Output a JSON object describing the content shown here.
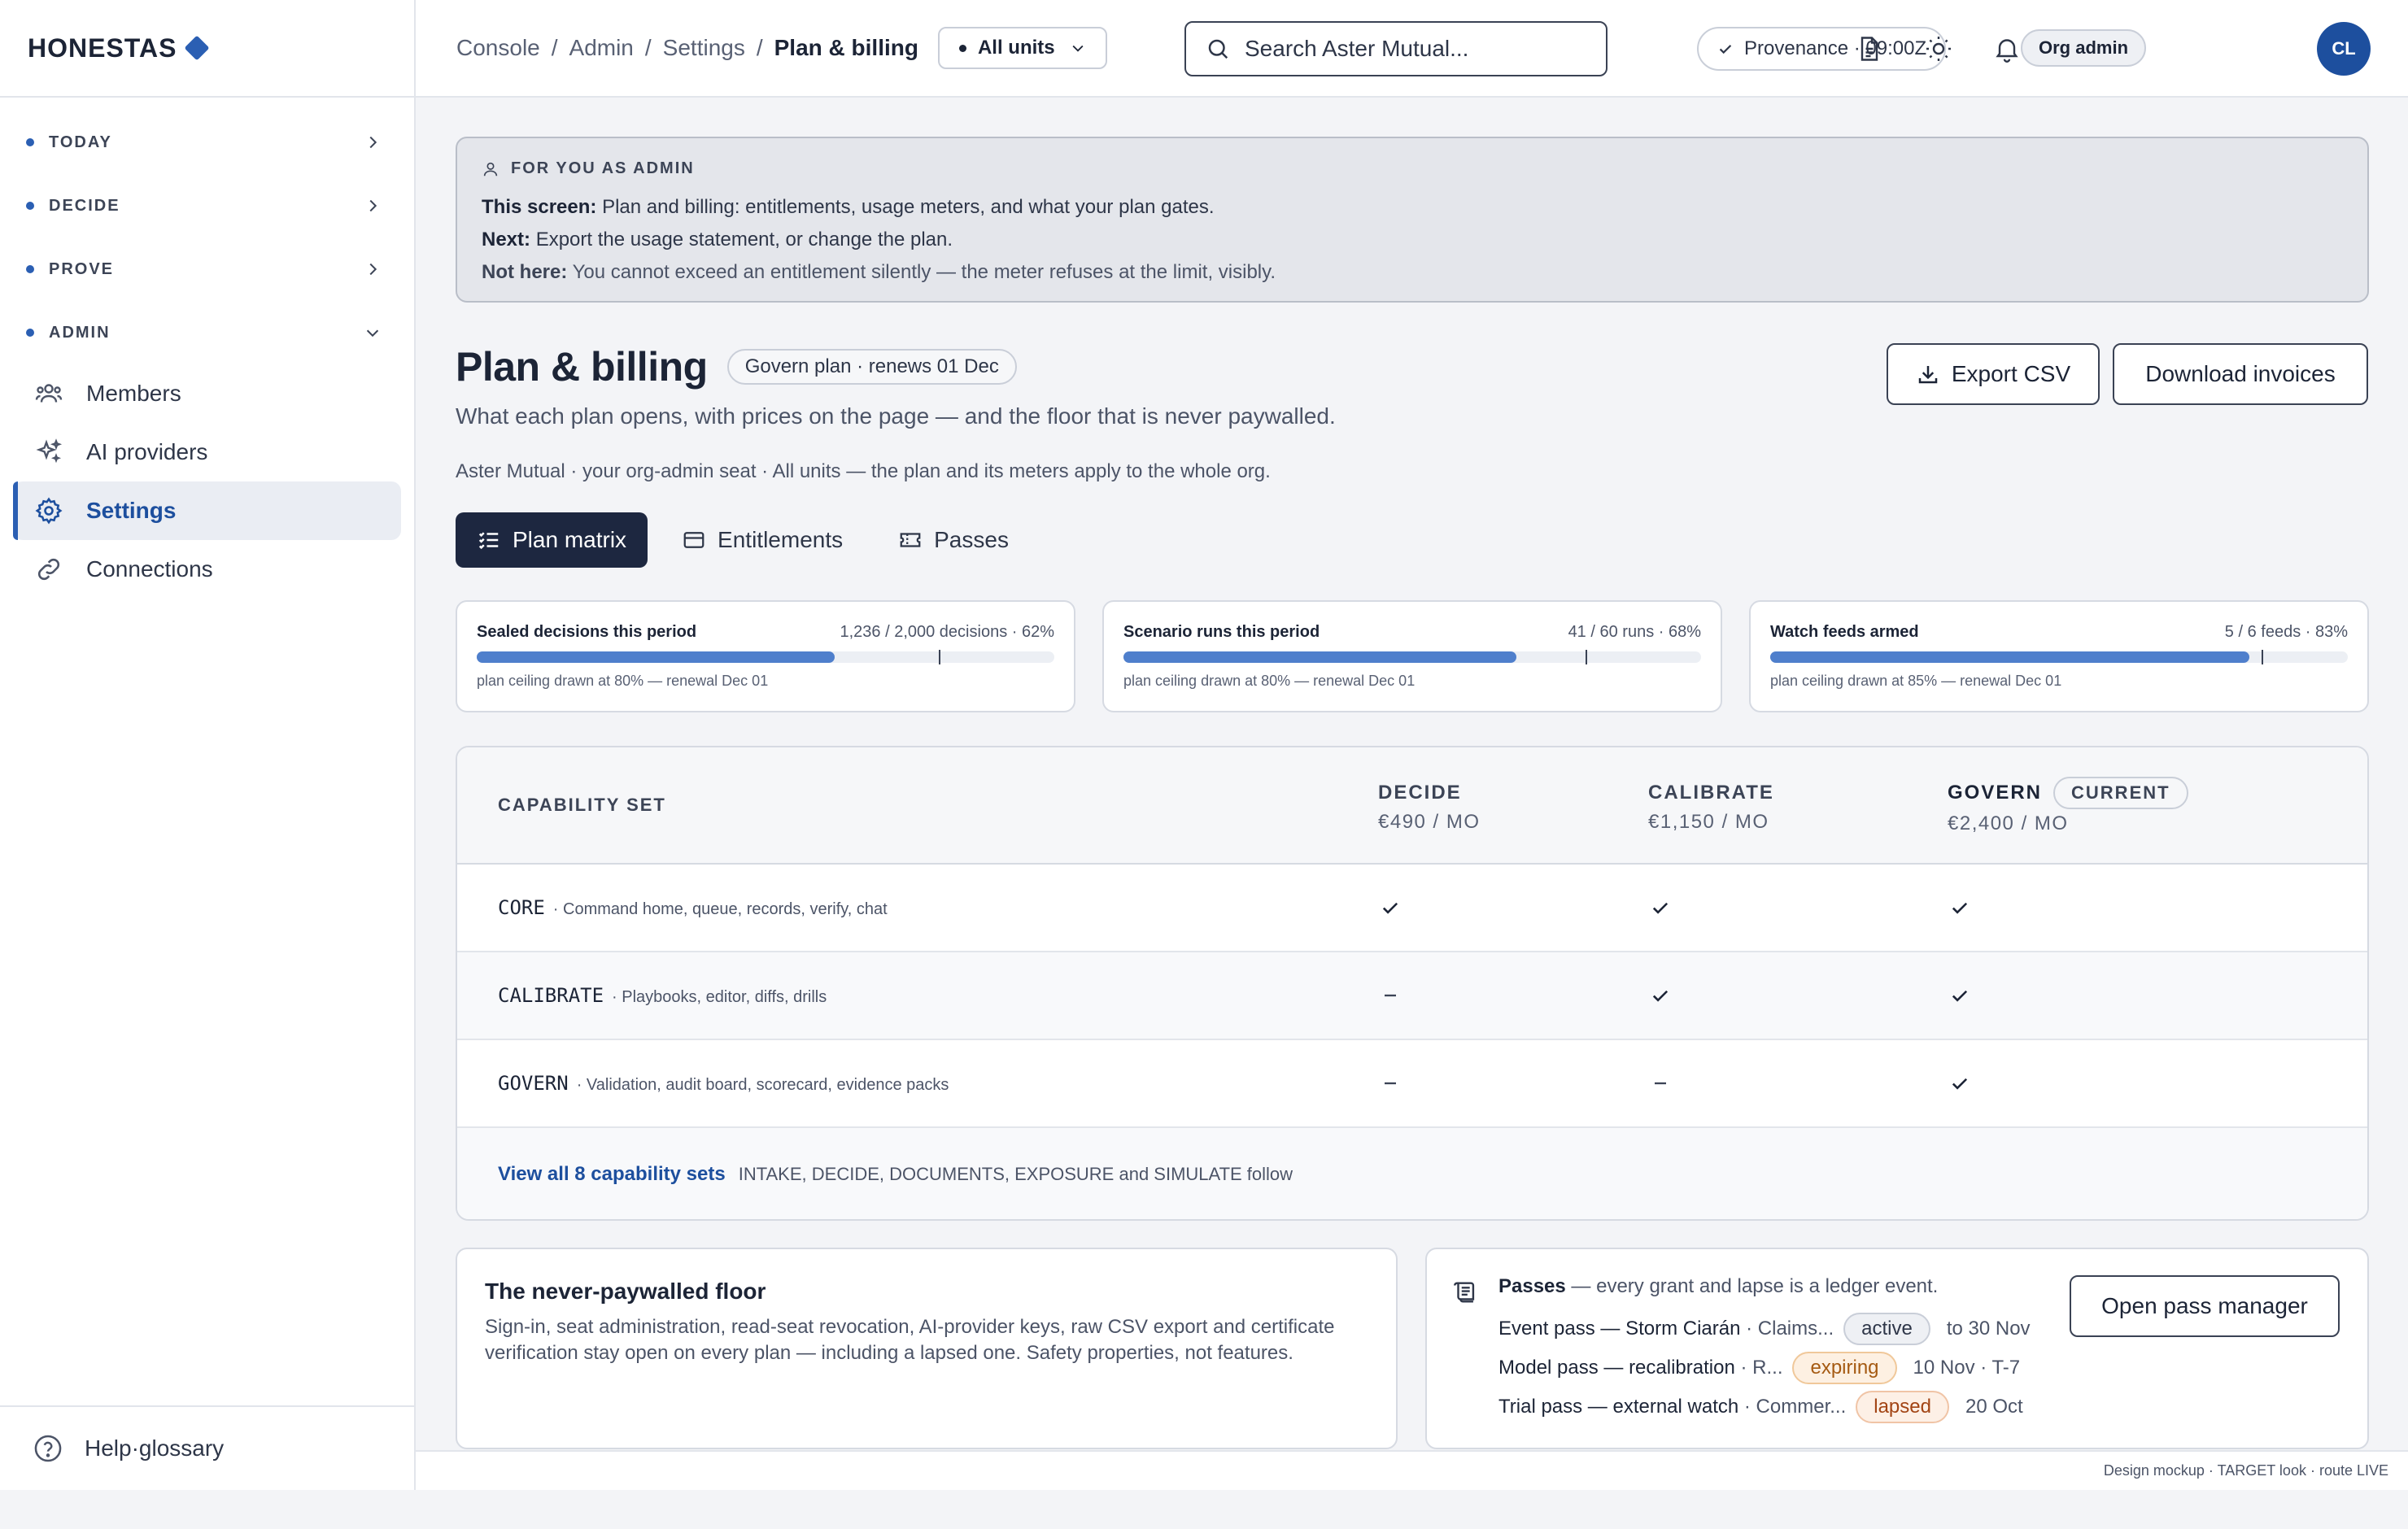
{
  "brand": {
    "name": "HONESTAS"
  },
  "nav": {
    "groups": [
      {
        "label": "TODAY"
      },
      {
        "label": "DECIDE"
      },
      {
        "label": "PROVE"
      },
      {
        "label": "ADMIN"
      }
    ],
    "admin_items": [
      {
        "label": "Members",
        "icon": "users-icon"
      },
      {
        "label": "AI providers",
        "icon": "sparkle-icon"
      },
      {
        "label": "Settings",
        "icon": "gear-icon",
        "active": true
      },
      {
        "label": "Connections",
        "icon": "link-icon"
      }
    ],
    "footer": {
      "label": "Help·glossary"
    }
  },
  "topbar": {
    "breadcrumb": [
      "Console",
      "Admin",
      "Settings",
      "Plan & billing"
    ],
    "units_label": "All units",
    "search_placeholder": "Search Aster Mutual...",
    "provenance": "Provenance · 09:00Z",
    "role": "Org admin",
    "avatar_initials": "CL"
  },
  "banner": {
    "kicker": "FOR YOU AS ADMIN",
    "lines": [
      {
        "label": "This screen:",
        "text": "Plan and billing: entitlements, usage meters, and what your plan gates."
      },
      {
        "label": "Next:",
        "text": "Export the usage statement, or change the plan."
      },
      {
        "label": "Not here:",
        "text": "You cannot exceed an entitlement silently — the meter refuses at the limit, visibly."
      }
    ]
  },
  "header": {
    "title": "Plan & billing",
    "plan_pill": "Govern plan · renews 01 Dec",
    "subtitle": "What each plan opens, with prices on the page — and the floor that is never paywalled.",
    "scope": "Aster Mutual · your org-admin seat · All units — the plan and its meters apply to the whole org.",
    "export_label": "Export CSV",
    "invoices_label": "Download invoices"
  },
  "tabs": [
    {
      "label": "Plan matrix",
      "active": true
    },
    {
      "label": "Entitlements"
    },
    {
      "label": "Passes"
    }
  ],
  "meters": [
    {
      "name": "Sealed decisions this period",
      "count": "1,236 / 2,000 decisions · 62%",
      "fill": 0.62,
      "ceiling": 0.8,
      "note": "plan ceiling drawn at 80% — renewal Dec 01"
    },
    {
      "name": "Scenario runs this period",
      "count": "41 / 60 runs · 68%",
      "fill": 0.68,
      "ceiling": 0.8,
      "note": "plan ceiling drawn at 80% — renewal Dec 01"
    },
    {
      "name": "Watch feeds armed",
      "count": "5 / 6 feeds · 83%",
      "fill": 0.83,
      "ceiling": 0.85,
      "note": "plan ceiling drawn at 85% — renewal Dec 01"
    }
  ],
  "matrix": {
    "capability_header": "CAPABILITY SET",
    "plans": [
      {
        "name": "DECIDE",
        "price": "€490 / MO"
      },
      {
        "name": "CALIBRATE",
        "price": "€1,150 / MO"
      },
      {
        "name": "GOVERN",
        "price": "€2,400 / MO",
        "current_label": "CURRENT"
      }
    ],
    "rows": [
      {
        "code": "CORE",
        "desc": "· Command home, queue, records, verify, chat",
        "cells": [
          "check",
          "check",
          "check"
        ]
      },
      {
        "code": "CALIBRATE",
        "desc": "· Playbooks, editor, diffs, drills",
        "cells": [
          "dash",
          "check",
          "check"
        ]
      },
      {
        "code": "GOVERN",
        "desc": "· Validation, audit board, scorecard, evidence packs",
        "cells": [
          "dash",
          "dash",
          "check"
        ]
      }
    ],
    "footer_link": "View all 8 capability sets",
    "footer_note": "INTAKE, DECIDE, DOCUMENTS, EXPOSURE and SIMULATE follow"
  },
  "floor": {
    "title": "The never-paywalled floor",
    "body": "Sign-in, seat administration, read-seat revocation, AI-provider keys, raw CSV export and certificate verification stay open on every plan — including a lapsed one. Safety properties, not features."
  },
  "passes": {
    "title": "Passes",
    "title_rest": "— every grant and lapse is a ledger event.",
    "items": [
      {
        "name": "Event pass — Storm Ciarán",
        "meta": "· Claims...",
        "status": "active",
        "when": "to 30 Nov"
      },
      {
        "name": "Model pass — recalibration",
        "meta": "· R...",
        "status": "expiring",
        "when": "10 Nov · T-7"
      },
      {
        "name": "Trial pass — external watch",
        "meta": "· Commer...",
        "status": "lapsed",
        "when": "20 Oct"
      }
    ],
    "open_label": "Open pass manager"
  },
  "status_bar": "Design mockup · TARGET look · route LIVE",
  "colors": {
    "accent": "#2b5fb3",
    "nav_dark": "#1d2740",
    "meter_fill": "#4f7fcc"
  }
}
